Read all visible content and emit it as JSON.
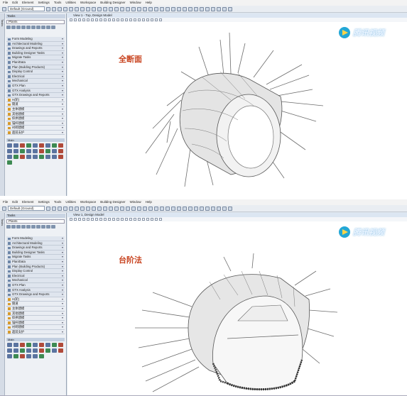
{
  "app": {
    "menu": [
      "File",
      "Edit",
      "Element",
      "Settings",
      "Tools",
      "Utilities",
      "Workspace",
      "Building Designer",
      "Window",
      "Help"
    ],
    "toolbar_combo": "Default (Ground)",
    "panel_title": "Tasks",
    "panel_search": "Plants",
    "view_title": "View 1 - Top, Design Model",
    "view_title_bottom": "View 1, Design Model",
    "palette_label": "Main",
    "tasks": [
      "Form Modeling",
      "Architectural Modeling",
      "Drawings and Reports",
      "Building Designer Tasks",
      "Migrate Tasks",
      "Plan/Data",
      "Plan (Building Products)",
      "Display Control",
      "Electrical",
      "Mechanical",
      "GTX Plan",
      "GTX Analysis",
      "GTX Drawings and Reports",
      "H(轮)",
      "隧道",
      "主体建模",
      "其他建模",
      "仰拱建模",
      "锚杆建模",
      "衬砌建模",
      "超前支护"
    ]
  },
  "top": {
    "caption": "全断面"
  },
  "bottom": {
    "caption": "台阶法"
  },
  "watermark": "腾讯视频"
}
